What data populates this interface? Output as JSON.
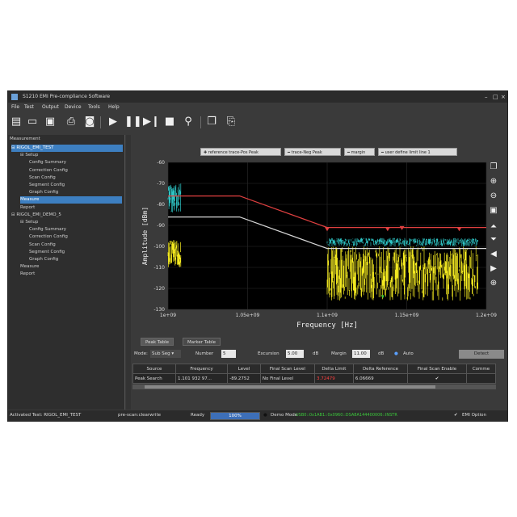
{
  "window": {
    "title": "S1210 EMI Pre-compliance Software"
  },
  "menu": [
    "File",
    "Test",
    "Output",
    "Device",
    "Tools",
    "Help"
  ],
  "toolbar": {
    "icons": [
      "new-file-icon",
      "open-folder-icon",
      "save-icon",
      "print-icon",
      "camera-icon",
      "play-icon",
      "pause-icon",
      "step-icon",
      "stop-icon",
      "search-icon",
      "copy-icon",
      "export-icon"
    ]
  },
  "tree": {
    "title": "Measurement",
    "items": [
      {
        "label": "RIGOL_EMI_TEST",
        "level": 0,
        "selected": true
      },
      {
        "label": "Setup",
        "level": 1
      },
      {
        "label": "Config Summary",
        "level": 2
      },
      {
        "label": "Correction Config",
        "level": 2
      },
      {
        "label": "Scan Config",
        "level": 2
      },
      {
        "label": "Segment Config",
        "level": 2
      },
      {
        "label": "Graph Config",
        "level": 2
      },
      {
        "label": "Measure",
        "level": 1,
        "selected": true
      },
      {
        "label": "Report",
        "level": 1
      },
      {
        "label": "RIGOL_EMI_DEMO_5",
        "level": 0
      },
      {
        "label": "Setup",
        "level": 1
      },
      {
        "label": "Config Summary",
        "level": 2
      },
      {
        "label": "Correction Config",
        "level": 2
      },
      {
        "label": "Scan Config",
        "level": 2
      },
      {
        "label": "Segment Config",
        "level": 2
      },
      {
        "label": "Graph Config",
        "level": 2
      },
      {
        "label": "Measure",
        "level": 1
      },
      {
        "label": "Report",
        "level": 1
      }
    ]
  },
  "legend_buttons": [
    "reference trace-Pos Peak",
    "trace-Neg Peak",
    "margin",
    "user define limit line 1"
  ],
  "chart_data": {
    "type": "line",
    "xlabel": "Frequency [Hz]",
    "ylabel": "Amplitude [dBm]",
    "xlim": [
      1000000000.0,
      1200000000.0
    ],
    "ylim": [
      -130,
      -60
    ],
    "xticks": [
      "1e+09",
      "1.05e+09",
      "1.1e+09",
      "1.15e+09",
      "1.2e+09"
    ],
    "yticks": [
      "-60",
      "-70",
      "-80",
      "-90",
      "-100",
      "-110",
      "-120",
      "-130"
    ],
    "grid": true,
    "series": [
      {
        "name": "reference trace-Pos Peak",
        "color": "#e04040",
        "x": [
          1000000000.0,
          1045000000.0,
          1100000000.0,
          1200000000.0
        ],
        "y": [
          -76,
          -76,
          -91,
          -91
        ]
      },
      {
        "name": "margin",
        "color": "#d8d8d8",
        "x": [
          1000000000.0,
          1045000000.0,
          1100000000.0,
          1200000000.0
        ],
        "y": [
          -86,
          -86,
          -101,
          -101
        ]
      }
    ],
    "noise_bands": [
      {
        "color": "#2ec4c4",
        "x": [
          1000000000.0,
          1008000000.0
        ],
        "y": [
          -70,
          -84
        ]
      },
      {
        "color": "#f2e820",
        "x": [
          1000000000.0,
          1008000000.0
        ],
        "y": [
          -97,
          -110
        ]
      },
      {
        "color": "#2ec4c4",
        "x": [
          1100000000.0,
          1195000000.0
        ],
        "y": [
          -96,
          -100
        ]
      },
      {
        "color": "#f2e820",
        "x": [
          1100000000.0,
          1195000000.0
        ],
        "y": [
          -100,
          -126
        ]
      }
    ],
    "peak_markers": [
      {
        "x": 1100000000.0,
        "y": -92
      },
      {
        "x": 1138000000.0,
        "y": -92
      },
      {
        "x": 1147000000.0,
        "y": -91.5
      },
      {
        "x": 1183000000.0,
        "y": -92
      }
    ]
  },
  "bottom": {
    "tabs": [
      "Peak Table",
      "Marker Table"
    ],
    "mode_label": "Mode:",
    "mode_value": "Sub Seg",
    "number_label": "Number",
    "number_value": "5",
    "excursion_label": "Excursion",
    "excursion_value": "5.00",
    "excursion_unit": "dB",
    "margin_label": "Margin",
    "margin_value": "11.00",
    "margin_unit": "dB",
    "auto_label": "Auto",
    "detect_label": "Detect",
    "table_headers": [
      "Source",
      "Frequency",
      "Level",
      "Final Scan Level",
      "Delta Limit",
      "Delta Reference",
      "Final Scan Enable",
      "Comme"
    ],
    "rows": [
      {
        "source": "Peak Search",
        "frequency": "1.101 932 97...",
        "level": "-89.2752",
        "final": "No Final Level",
        "delta_limit": "3.72479",
        "delta_ref": "6.06669",
        "enable": "✔",
        "comment": ""
      }
    ]
  },
  "status": {
    "activated": "Activated Test:  RIGOL_EMI_TEST",
    "scan": "pre-scan:clearwrite",
    "ready": "Ready",
    "progress_pct": 100,
    "progress_text": "100%",
    "demo": "Demo Mode",
    "device": "USB0::0x1AB1::0x0960::DSA8A144400006::INSTR",
    "emi_option": "EMI Option"
  },
  "colors": {
    "delta_limit_text": "#ff4040",
    "device_text": "#3cc83c",
    "selection": "#3d7fc1"
  }
}
